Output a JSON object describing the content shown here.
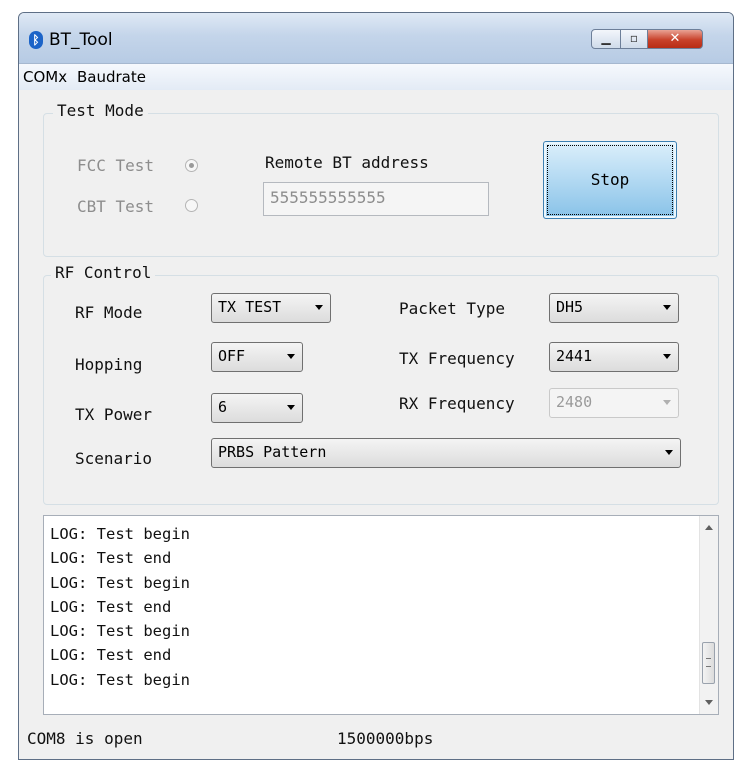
{
  "window": {
    "title": "BT_Tool",
    "app_icon": "bluetooth-icon"
  },
  "menu": {
    "items": [
      "COMx",
      "Baudrate"
    ]
  },
  "test_mode": {
    "group_label": "Test Mode",
    "fcc_label": "FCC Test",
    "fcc_selected": true,
    "cbt_label": "CBT Test",
    "cbt_selected": false,
    "remote_label": "Remote BT address",
    "remote_value": "555555555555",
    "stop_label": "Stop"
  },
  "rf_control": {
    "group_label": "RF Control",
    "rf_mode_label": "RF Mode",
    "rf_mode_value": "TX TEST",
    "hopping_label": "Hopping",
    "hopping_value": "OFF",
    "tx_power_label": "TX Power",
    "tx_power_value": "6",
    "scenario_label": "Scenario",
    "scenario_value": "PRBS Pattern",
    "packet_type_label": "Packet Type",
    "packet_type_value": "DH5",
    "tx_freq_label": "TX Frequency",
    "tx_freq_value": "2441",
    "rx_freq_label": "RX Frequency",
    "rx_freq_value": "2480"
  },
  "log": {
    "lines": [
      "LOG: Test begin",
      "LOG: Test end",
      "LOG: Test begin",
      "LOG: Test end",
      "LOG: Test begin",
      "LOG: Test end",
      "LOG: Test begin"
    ]
  },
  "status": {
    "port": "COM8 is open",
    "baud": "1500000bps"
  },
  "colors": {
    "stop_button": "#b2d9f2",
    "titlebar": "#c4d5ea",
    "close_button": "#c8412a"
  }
}
